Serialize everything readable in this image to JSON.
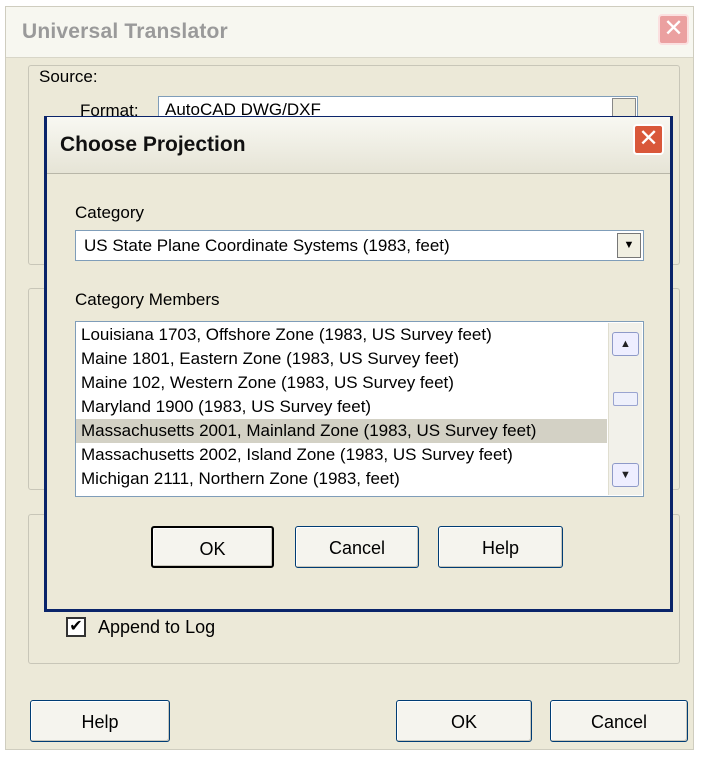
{
  "outer_window": {
    "title": "Universal Translator",
    "source_group_label": "Source:",
    "format_label": "Format:",
    "format_value": "AutoCAD DWG/DXF",
    "append_checked": "✔",
    "append_label": "Append to Log",
    "help_label": "Help",
    "ok_label": "OK",
    "cancel_label": "Cancel"
  },
  "dialog": {
    "title": "Choose Projection",
    "category_label": "Category",
    "category_value": "US State Plane Coordinate Systems (1983, feet)",
    "members_label": "Category Members",
    "members": [
      "Louisiana 1703, Offshore Zone (1983, US Survey feet)",
      "Maine 1801, Eastern Zone (1983, US Survey feet)",
      "Maine 102, Western Zone (1983, US Survey feet)",
      "Maryland 1900 (1983, US Survey feet)",
      "Massachusetts 2001, Mainland Zone (1983, US Survey feet)",
      "Massachusetts 2002, Island Zone (1983, US Survey feet)",
      "Michigan 2111, Northern Zone (1983, feet)"
    ],
    "ok_label": "OK",
    "cancel_label": "Cancel",
    "help_label": "Help"
  },
  "icons": {
    "close": "✕",
    "dropdown": "▼",
    "scroll_up": "▲",
    "scroll_down": "▼"
  },
  "colors": {
    "dialog_background": "#ece9d8",
    "selection": "#d3d1c5",
    "close_button": "#d9583a"
  }
}
